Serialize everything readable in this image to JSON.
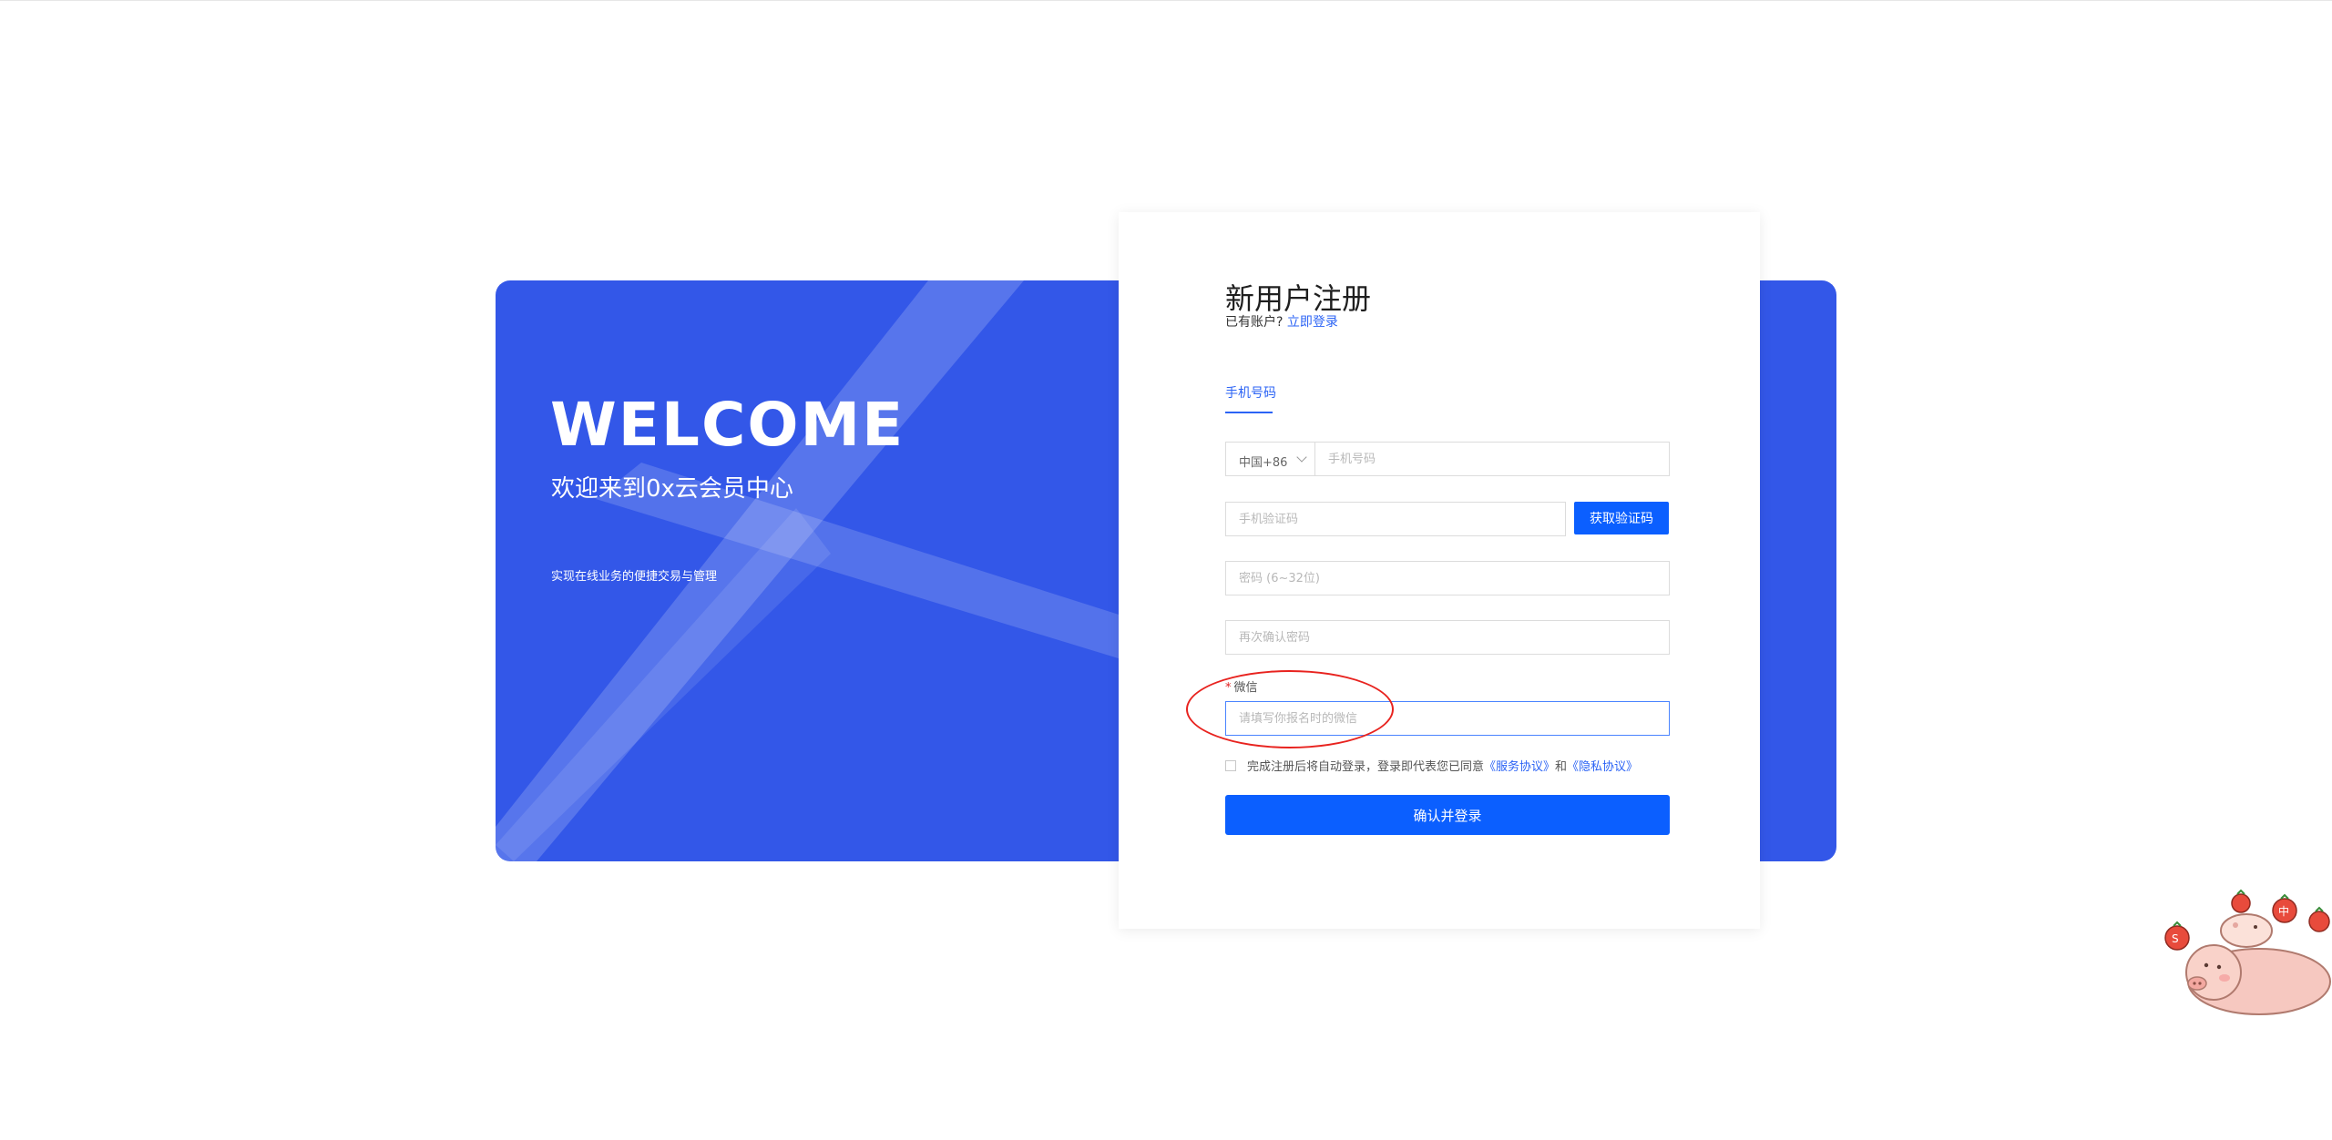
{
  "banner": {
    "welcome": "WELCOME",
    "subtitle": "欢迎来到0x云会员中心",
    "slogan": "实现在线业务的便捷交易与管理",
    "color": "#3357e8"
  },
  "form": {
    "title": "新用户注册",
    "have_account": "已有账户?",
    "login_link": "立即登录",
    "tab_phone": "手机号码",
    "country_code": "中国+86",
    "phone_placeholder": "手机号码",
    "sms_placeholder": "手机验证码",
    "get_code_label": "获取验证码",
    "password_placeholder": "密码 (6~32位)",
    "confirm_placeholder": "再次确认密码",
    "wechat_required_mark": "*",
    "wechat_label": "微信",
    "wechat_placeholder": "请填写你报名时的微信",
    "agree_text": "完成注册后将自动登录，登录即代表您已同意",
    "service_link": "《服务协议》",
    "and_text": "和",
    "privacy_link": "《隐私协议》",
    "submit_label": "确认并登录",
    "accent_color": "#0b5fff"
  },
  "mascot": {
    "icon": "pig-mascot-icon"
  }
}
